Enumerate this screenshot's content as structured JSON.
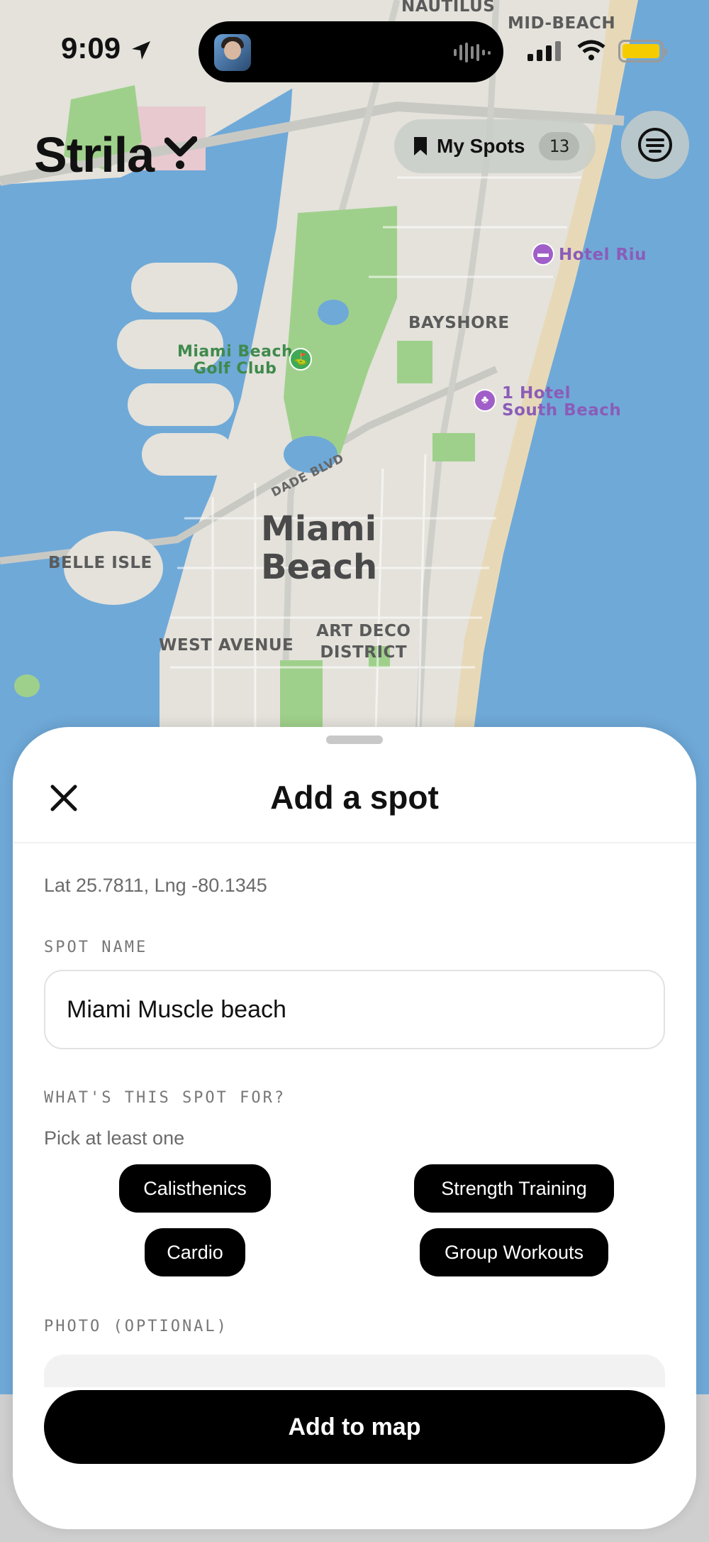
{
  "status_bar": {
    "time": "9:09"
  },
  "map": {
    "labels": {
      "nautilus": "NAUTILUS",
      "mid_beach": "MID-BEACH",
      "bayshore": "BAYSHORE",
      "golf_club": "Miami Beach\nGolf Club",
      "hotel_riu": "Hotel Riu",
      "one_hotel": "1 Hotel\nSouth Beach",
      "dade_blvd": "DADE BLVD",
      "miami_beach": "Miami\nBeach",
      "belle_isle": "BELLE ISLE",
      "west_avenue": "WEST AVENUE",
      "art_deco": "ART DECO\nDISTRICT"
    }
  },
  "header": {
    "logo": "Strila",
    "my_spots_label": "My Spots",
    "my_spots_count": "13"
  },
  "sheet": {
    "title": "Add a spot",
    "coords": "Lat 25.7811, Lng -80.1345",
    "spot_name_label": "SPOT NAME",
    "spot_name_value": "Miami Muscle beach",
    "purpose_label": "WHAT'S THIS SPOT FOR?",
    "purpose_hint": "Pick at least one",
    "chips": [
      "Calisthenics",
      "Strength Training",
      "Cardio",
      "Group Workouts"
    ],
    "photo_label": "PHOTO (OPTIONAL)",
    "submit_label": "Add to map"
  },
  "colors": {
    "water": "#6fa9d8",
    "land": "#e5e3dc",
    "park": "#9fd08b",
    "accent": "#000000",
    "battery": "#f5cc00"
  }
}
